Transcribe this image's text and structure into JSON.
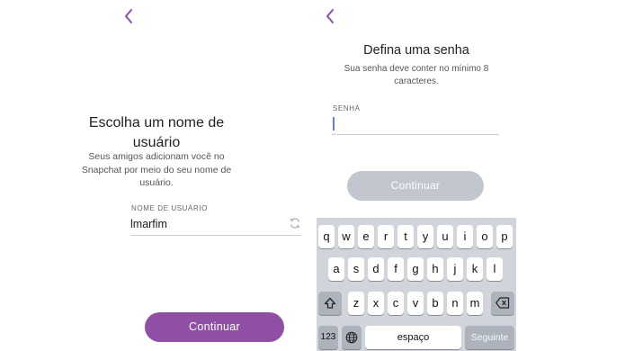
{
  "left_screen": {
    "title_line1": "Escolha um nome de",
    "title_line2": "usuário",
    "subtitle_line1": "Seus amigos adicionam você no",
    "subtitle_line2": "Snapchat por meio do seu nome de",
    "subtitle_line3": "usuário.",
    "field_label": "NOME DE USUÁRIO",
    "username_value": "lmarfim",
    "continue_label": "Continuar"
  },
  "right_screen": {
    "title": "Defina uma senha",
    "subtitle_line1": "Sua senha deve conter no mínimo 8",
    "subtitle_line2": "caracteres.",
    "field_label": "SENHA",
    "password_value": "",
    "continue_label": "Continuar"
  },
  "keyboard": {
    "row1": [
      "q",
      "w",
      "e",
      "r",
      "t",
      "y",
      "u",
      "i",
      "o",
      "p"
    ],
    "row2": [
      "a",
      "s",
      "d",
      "f",
      "g",
      "h",
      "j",
      "k",
      "l"
    ],
    "row3": [
      "z",
      "x",
      "c",
      "v",
      "b",
      "n",
      "m"
    ],
    "numbers_label": "123",
    "space_label": "espaço",
    "next_label": "Seguinte"
  },
  "colors": {
    "accent_purple": "#8e4fa4",
    "disabled_button": "#c1c6cf",
    "caret_blue": "#6a7bd8",
    "keyboard_bg": "#d1d5db"
  },
  "icons": [
    "back-chevron-icon",
    "refresh-icon",
    "shift-icon",
    "backspace-icon",
    "globe-icon"
  ]
}
